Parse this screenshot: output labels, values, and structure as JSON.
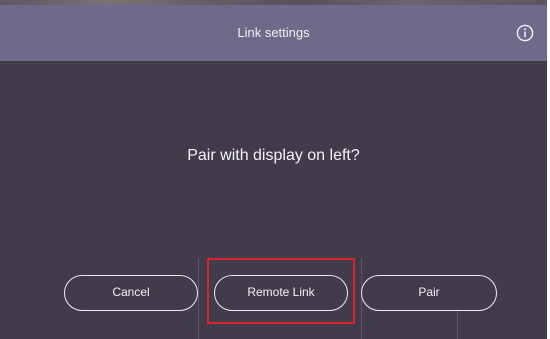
{
  "header": {
    "title": "Link settings",
    "info_icon": "info-circle-icon"
  },
  "dialog": {
    "prompt": "Pair with display on left?"
  },
  "buttons": {
    "cancel_label": "Cancel",
    "remote_link_label": "Remote Link",
    "pair_label": "Pair"
  },
  "annotation": {
    "highlight_target": "remote-link-button"
  },
  "colors": {
    "background": "#413b4a",
    "title_bar": "#6f6a8a",
    "text": "#f2f1f6",
    "button_border": "#eceaf2",
    "highlight": "#d9232e"
  }
}
